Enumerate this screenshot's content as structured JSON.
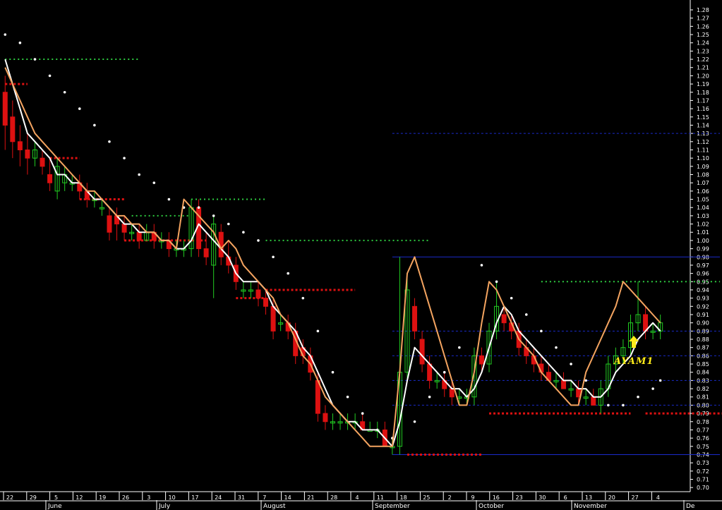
{
  "chart_data": {
    "type": "line",
    "subtype": "candlestick",
    "title": "",
    "xlabel": "",
    "ylabel": "",
    "ylim": [
      0.7,
      1.29
    ],
    "y_ticks": [
      0.7,
      0.71,
      0.72,
      0.73,
      0.74,
      0.75,
      0.76,
      0.77,
      0.78,
      0.79,
      0.8,
      0.81,
      0.82,
      0.83,
      0.84,
      0.85,
      0.86,
      0.87,
      0.88,
      0.89,
      0.9,
      0.91,
      0.92,
      0.93,
      0.94,
      0.95,
      0.96,
      0.97,
      0.98,
      0.99,
      1.0,
      1.01,
      1.02,
      1.03,
      1.04,
      1.05,
      1.06,
      1.07,
      1.08,
      1.09,
      1.1,
      1.11,
      1.12,
      1.13,
      1.14,
      1.15,
      1.16,
      1.17,
      1.18,
      1.19,
      1.2,
      1.21,
      1.22,
      1.23,
      1.24,
      1.25,
      1.26,
      1.27,
      1.28
    ],
    "y_axis_side": "right",
    "x_day_ticks": [
      "22",
      "29",
      "5",
      "12",
      "19",
      "26",
      "3",
      "10",
      "17",
      "24",
      "31",
      "7",
      "14",
      "21",
      "28",
      "4",
      "11",
      "18",
      "25",
      "2",
      "9",
      "16",
      "23",
      "30",
      "6",
      "13",
      "20",
      "27",
      "4"
    ],
    "x_months": [
      "June",
      "July",
      "August",
      "September",
      "October",
      "November",
      "De"
    ],
    "grid": false,
    "annotations": [
      {
        "text": "AYAM1",
        "marker": "yellow up arrow"
      }
    ],
    "colors": {
      "background": "#000000",
      "up_candle": "#22cc22",
      "down_candle": "#dd1111",
      "fast_line": "#ffffff",
      "slow_line": "#f4a460",
      "parabolic_sar": "#ffffff",
      "support_line": "#1a2bcc",
      "resistance_dotted": "#2ecc40",
      "stop_dotted": "#dd1111",
      "annotation": "#ffeb1a"
    },
    "candles": [
      {
        "t": 0,
        "o": 1.18,
        "h": 1.2,
        "l": 1.11,
        "c": 1.14
      },
      {
        "t": 1,
        "o": 1.15,
        "h": 1.17,
        "l": 1.1,
        "c": 1.12
      },
      {
        "t": 2,
        "o": 1.12,
        "h": 1.14,
        "l": 1.09,
        "c": 1.11
      },
      {
        "t": 3,
        "o": 1.11,
        "h": 1.13,
        "l": 1.08,
        "c": 1.1
      },
      {
        "t": 4,
        "o": 1.1,
        "h": 1.12,
        "l": 1.09,
        "c": 1.11
      },
      {
        "t": 5,
        "o": 1.1,
        "h": 1.11,
        "l": 1.08,
        "c": 1.09
      },
      {
        "t": 6,
        "o": 1.08,
        "h": 1.1,
        "l": 1.06,
        "c": 1.07
      },
      {
        "t": 7,
        "o": 1.06,
        "h": 1.1,
        "l": 1.05,
        "c": 1.09
      },
      {
        "t": 8,
        "o": 1.07,
        "h": 1.09,
        "l": 1.06,
        "c": 1.08
      },
      {
        "t": 9,
        "o": 1.07,
        "h": 1.08,
        "l": 1.06,
        "c": 1.07
      },
      {
        "t": 10,
        "o": 1.07,
        "h": 1.08,
        "l": 1.05,
        "c": 1.06
      },
      {
        "t": 11,
        "o": 1.06,
        "h": 1.07,
        "l": 1.04,
        "c": 1.05
      },
      {
        "t": 12,
        "o": 1.05,
        "h": 1.06,
        "l": 1.04,
        "c": 1.05
      },
      {
        "t": 13,
        "o": 1.04,
        "h": 1.05,
        "l": 1.03,
        "c": 1.04
      },
      {
        "t": 14,
        "o": 1.03,
        "h": 1.04,
        "l": 1.0,
        "c": 1.01
      },
      {
        "t": 15,
        "o": 1.03,
        "h": 1.04,
        "l": 1.0,
        "c": 1.02
      },
      {
        "t": 16,
        "o": 1.02,
        "h": 1.03,
        "l": 1.0,
        "c": 1.01
      },
      {
        "t": 17,
        "o": 1.01,
        "h": 1.02,
        "l": 1.0,
        "c": 1.01
      },
      {
        "t": 18,
        "o": 1.01,
        "h": 1.02,
        "l": 0.99,
        "c": 1.0
      },
      {
        "t": 19,
        "o": 1.0,
        "h": 1.02,
        "l": 1.0,
        "c": 1.01
      },
      {
        "t": 20,
        "o": 1.01,
        "h": 1.02,
        "l": 0.99,
        "c": 1.0
      },
      {
        "t": 21,
        "o": 1.0,
        "h": 1.01,
        "l": 0.99,
        "c": 1.0
      },
      {
        "t": 22,
        "o": 1.0,
        "h": 1.01,
        "l": 0.98,
        "c": 0.99
      },
      {
        "t": 23,
        "o": 0.99,
        "h": 1.0,
        "l": 0.98,
        "c": 0.99
      },
      {
        "t": 24,
        "o": 0.99,
        "h": 1.0,
        "l": 0.98,
        "c": 0.99
      },
      {
        "t": 25,
        "o": 0.99,
        "h": 1.05,
        "l": 0.98,
        "c": 1.04
      },
      {
        "t": 26,
        "o": 1.04,
        "h": 1.05,
        "l": 0.98,
        "c": 0.99
      },
      {
        "t": 27,
        "o": 0.99,
        "h": 1.01,
        "l": 0.97,
        "c": 0.98
      },
      {
        "t": 28,
        "o": 0.97,
        "h": 1.03,
        "l": 0.93,
        "c": 1.02
      },
      {
        "t": 29,
        "o": 1.01,
        "h": 1.02,
        "l": 0.97,
        "c": 0.98
      },
      {
        "t": 30,
        "o": 0.98,
        "h": 1.0,
        "l": 0.96,
        "c": 0.97
      },
      {
        "t": 31,
        "o": 0.97,
        "h": 0.98,
        "l": 0.94,
        "c": 0.95
      },
      {
        "t": 32,
        "o": 0.94,
        "h": 0.95,
        "l": 0.93,
        "c": 0.94
      },
      {
        "t": 33,
        "o": 0.94,
        "h": 0.95,
        "l": 0.93,
        "c": 0.94
      },
      {
        "t": 34,
        "o": 0.94,
        "h": 0.95,
        "l": 0.92,
        "c": 0.93
      },
      {
        "t": 35,
        "o": 0.93,
        "h": 0.94,
        "l": 0.91,
        "c": 0.92
      },
      {
        "t": 36,
        "o": 0.92,
        "h": 0.93,
        "l": 0.88,
        "c": 0.89
      },
      {
        "t": 37,
        "o": 0.9,
        "h": 0.91,
        "l": 0.89,
        "c": 0.9
      },
      {
        "t": 38,
        "o": 0.9,
        "h": 0.91,
        "l": 0.88,
        "c": 0.89
      },
      {
        "t": 39,
        "o": 0.89,
        "h": 0.9,
        "l": 0.85,
        "c": 0.86
      },
      {
        "t": 40,
        "o": 0.87,
        "h": 0.88,
        "l": 0.85,
        "c": 0.86
      },
      {
        "t": 41,
        "o": 0.86,
        "h": 0.87,
        "l": 0.83,
        "c": 0.84
      },
      {
        "t": 42,
        "o": 0.83,
        "h": 0.84,
        "l": 0.78,
        "c": 0.79
      },
      {
        "t": 43,
        "o": 0.79,
        "h": 0.8,
        "l": 0.77,
        "c": 0.78
      },
      {
        "t": 44,
        "o": 0.78,
        "h": 0.79,
        "l": 0.77,
        "c": 0.78
      },
      {
        "t": 45,
        "o": 0.78,
        "h": 0.79,
        "l": 0.77,
        "c": 0.78
      },
      {
        "t": 46,
        "o": 0.78,
        "h": 0.79,
        "l": 0.77,
        "c": 0.78
      },
      {
        "t": 47,
        "o": 0.78,
        "h": 0.79,
        "l": 0.77,
        "c": 0.78
      },
      {
        "t": 48,
        "o": 0.78,
        "h": 0.79,
        "l": 0.77,
        "c": 0.77
      },
      {
        "t": 49,
        "o": 0.77,
        "h": 0.78,
        "l": 0.77,
        "c": 0.77
      },
      {
        "t": 50,
        "o": 0.77,
        "h": 0.78,
        "l": 0.76,
        "c": 0.77
      },
      {
        "t": 51,
        "o": 0.77,
        "h": 0.78,
        "l": 0.75,
        "c": 0.75
      },
      {
        "t": 52,
        "o": 0.75,
        "h": 0.76,
        "l": 0.74,
        "c": 0.75
      },
      {
        "t": 53,
        "o": 0.75,
        "h": 0.98,
        "l": 0.74,
        "c": 0.84
      },
      {
        "t": 54,
        "o": 0.84,
        "h": 0.96,
        "l": 0.83,
        "c": 0.94
      },
      {
        "t": 55,
        "o": 0.92,
        "h": 0.93,
        "l": 0.88,
        "c": 0.89
      },
      {
        "t": 56,
        "o": 0.88,
        "h": 0.89,
        "l": 0.84,
        "c": 0.85
      },
      {
        "t": 57,
        "o": 0.85,
        "h": 0.86,
        "l": 0.82,
        "c": 0.83
      },
      {
        "t": 58,
        "o": 0.83,
        "h": 0.84,
        "l": 0.82,
        "c": 0.83
      },
      {
        "t": 59,
        "o": 0.83,
        "h": 0.84,
        "l": 0.81,
        "c": 0.82
      },
      {
        "t": 60,
        "o": 0.82,
        "h": 0.83,
        "l": 0.8,
        "c": 0.81
      },
      {
        "t": 61,
        "o": 0.81,
        "h": 0.82,
        "l": 0.8,
        "c": 0.81
      },
      {
        "t": 62,
        "o": 0.81,
        "h": 0.82,
        "l": 0.8,
        "c": 0.81
      },
      {
        "t": 63,
        "o": 0.81,
        "h": 0.87,
        "l": 0.8,
        "c": 0.86
      },
      {
        "t": 64,
        "o": 0.86,
        "h": 0.87,
        "l": 0.84,
        "c": 0.85
      },
      {
        "t": 65,
        "o": 0.85,
        "h": 0.9,
        "l": 0.84,
        "c": 0.89
      },
      {
        "t": 66,
        "o": 0.89,
        "h": 0.95,
        "l": 0.88,
        "c": 0.92
      },
      {
        "t": 67,
        "o": 0.91,
        "h": 0.92,
        "l": 0.89,
        "c": 0.9
      },
      {
        "t": 68,
        "o": 0.9,
        "h": 0.91,
        "l": 0.88,
        "c": 0.89
      },
      {
        "t": 69,
        "o": 0.89,
        "h": 0.9,
        "l": 0.86,
        "c": 0.87
      },
      {
        "t": 70,
        "o": 0.87,
        "h": 0.88,
        "l": 0.85,
        "c": 0.86
      },
      {
        "t": 71,
        "o": 0.86,
        "h": 0.87,
        "l": 0.84,
        "c": 0.85
      },
      {
        "t": 72,
        "o": 0.85,
        "h": 0.86,
        "l": 0.83,
        "c": 0.84
      },
      {
        "t": 73,
        "o": 0.84,
        "h": 0.85,
        "l": 0.83,
        "c": 0.83
      },
      {
        "t": 74,
        "o": 0.83,
        "h": 0.84,
        "l": 0.82,
        "c": 0.83
      },
      {
        "t": 75,
        "o": 0.83,
        "h": 0.84,
        "l": 0.82,
        "c": 0.82
      },
      {
        "t": 76,
        "o": 0.82,
        "h": 0.83,
        "l": 0.81,
        "c": 0.82
      },
      {
        "t": 77,
        "o": 0.82,
        "h": 0.83,
        "l": 0.8,
        "c": 0.81
      },
      {
        "t": 78,
        "o": 0.81,
        "h": 0.82,
        "l": 0.8,
        "c": 0.81
      },
      {
        "t": 79,
        "o": 0.81,
        "h": 0.82,
        "l": 0.8,
        "c": 0.8
      },
      {
        "t": 80,
        "o": 0.8,
        "h": 0.83,
        "l": 0.79,
        "c": 0.82
      },
      {
        "t": 81,
        "o": 0.82,
        "h": 0.86,
        "l": 0.81,
        "c": 0.85
      },
      {
        "t": 82,
        "o": 0.85,
        "h": 0.87,
        "l": 0.84,
        "c": 0.86
      },
      {
        "t": 83,
        "o": 0.86,
        "h": 0.88,
        "l": 0.85,
        "c": 0.87
      },
      {
        "t": 84,
        "o": 0.87,
        "h": 0.91,
        "l": 0.86,
        "c": 0.9
      },
      {
        "t": 85,
        "o": 0.9,
        "h": 0.95,
        "l": 0.89,
        "c": 0.91
      },
      {
        "t": 86,
        "o": 0.91,
        "h": 0.92,
        "l": 0.88,
        "c": 0.89
      },
      {
        "t": 87,
        "o": 0.89,
        "h": 0.9,
        "l": 0.88,
        "c": 0.89
      },
      {
        "t": 88,
        "o": 0.89,
        "h": 0.91,
        "l": 0.88,
        "c": 0.9
      }
    ],
    "series": [
      {
        "values": [
          1.22,
          1.19,
          1.16,
          1.13,
          1.12,
          1.11,
          1.1,
          1.08,
          1.08,
          1.07,
          1.07,
          1.06,
          1.05,
          1.05,
          1.04,
          1.03,
          1.02,
          1.02,
          1.01,
          1.01,
          1.01,
          1.0,
          1.0,
          0.99,
          0.99,
          1.0,
          1.02,
          1.01,
          1.0,
          0.99,
          0.98,
          0.96,
          0.95,
          0.95,
          0.95,
          0.94,
          0.92,
          0.91,
          0.9,
          0.89,
          0.87,
          0.86,
          0.84,
          0.82,
          0.8,
          0.79,
          0.78,
          0.78,
          0.77,
          0.77,
          0.77,
          0.76,
          0.75,
          0.78,
          0.83,
          0.87,
          0.86,
          0.85,
          0.84,
          0.83,
          0.82,
          0.82,
          0.81,
          0.82,
          0.84,
          0.87,
          0.9,
          0.92,
          0.91,
          0.89,
          0.88,
          0.87,
          0.86,
          0.85,
          0.84,
          0.83,
          0.83,
          0.82,
          0.82,
          0.81,
          0.81,
          0.82,
          0.84,
          0.85,
          0.86,
          0.88,
          0.89,
          0.9,
          0.89
        ]
      },
      {
        "values": [
          1.21,
          1.19,
          1.17,
          1.15,
          1.13,
          1.12,
          1.11,
          1.1,
          1.09,
          1.08,
          1.07,
          1.06,
          1.06,
          1.05,
          1.04,
          1.03,
          1.03,
          1.02,
          1.02,
          1.01,
          1.01,
          1.0,
          1.0,
          0.99,
          1.05,
          1.04,
          1.03,
          1.02,
          1.01,
          0.99,
          1.0,
          0.99,
          0.97,
          0.96,
          0.95,
          0.94,
          0.93,
          0.91,
          0.9,
          0.88,
          0.86,
          0.85,
          0.83,
          0.81,
          0.8,
          0.79,
          0.78,
          0.77,
          0.76,
          0.75,
          0.75,
          0.75,
          0.75,
          0.84,
          0.96,
          0.98,
          0.95,
          0.92,
          0.89,
          0.86,
          0.83,
          0.8,
          0.8,
          0.84,
          0.9,
          0.95,
          0.94,
          0.92,
          0.9,
          0.88,
          0.87,
          0.86,
          0.84,
          0.83,
          0.82,
          0.81,
          0.8,
          0.8,
          0.84,
          0.86,
          0.88,
          0.9,
          0.92,
          0.95,
          0.94,
          0.93,
          0.92,
          0.91,
          0.9
        ]
      }
    ],
    "sar": [
      {
        "t": 0,
        "v": 1.25
      },
      {
        "t": 2,
        "v": 1.24
      },
      {
        "t": 4,
        "v": 1.22
      },
      {
        "t": 6,
        "v": 1.2
      },
      {
        "t": 8,
        "v": 1.18
      },
      {
        "t": 10,
        "v": 1.16
      },
      {
        "t": 12,
        "v": 1.14
      },
      {
        "t": 14,
        "v": 1.12
      },
      {
        "t": 16,
        "v": 1.1
      },
      {
        "t": 18,
        "v": 1.08
      },
      {
        "t": 20,
        "v": 1.07
      },
      {
        "t": 22,
        "v": 1.05
      },
      {
        "t": 24,
        "v": 1.04
      },
      {
        "t": 26,
        "v": 1.04
      },
      {
        "t": 28,
        "v": 1.03
      },
      {
        "t": 30,
        "v": 1.02
      },
      {
        "t": 32,
        "v": 1.01
      },
      {
        "t": 34,
        "v": 1.0
      },
      {
        "t": 36,
        "v": 0.98
      },
      {
        "t": 38,
        "v": 0.96
      },
      {
        "t": 40,
        "v": 0.93
      },
      {
        "t": 42,
        "v": 0.89
      },
      {
        "t": 44,
        "v": 0.84
      },
      {
        "t": 46,
        "v": 0.81
      },
      {
        "t": 48,
        "v": 0.79
      },
      {
        "t": 50,
        "v": 0.77
      },
      {
        "t": 52,
        "v": 0.76
      },
      {
        "t": 55,
        "v": 0.78
      },
      {
        "t": 57,
        "v": 0.81
      },
      {
        "t": 59,
        "v": 0.84
      },
      {
        "t": 61,
        "v": 0.87
      },
      {
        "t": 64,
        "v": 0.97
      },
      {
        "t": 66,
        "v": 0.95
      },
      {
        "t": 68,
        "v": 0.93
      },
      {
        "t": 70,
        "v": 0.91
      },
      {
        "t": 72,
        "v": 0.89
      },
      {
        "t": 74,
        "v": 0.87
      },
      {
        "t": 76,
        "v": 0.85
      },
      {
        "t": 78,
        "v": 0.83
      },
      {
        "t": 81,
        "v": 0.8
      },
      {
        "t": 83,
        "v": 0.8
      },
      {
        "t": 85,
        "v": 0.81
      },
      {
        "t": 87,
        "v": 0.82
      },
      {
        "t": 88,
        "v": 0.83
      }
    ],
    "support_lines": [
      {
        "y": 1.13,
        "x0": 52,
        "x1": 96,
        "dashed": true
      },
      {
        "y": 0.98,
        "x0": 52,
        "x1": 96,
        "dashed": false
      },
      {
        "y": 0.89,
        "x0": 52,
        "x1": 96,
        "dashed": true
      },
      {
        "y": 0.86,
        "x0": 52,
        "x1": 96,
        "dashed": true
      },
      {
        "y": 0.83,
        "x0": 52,
        "x1": 96,
        "dashed": true
      },
      {
        "y": 0.8,
        "x0": 52,
        "x1": 96,
        "dashed": true
      },
      {
        "y": 0.74,
        "x0": 52,
        "x1": 96,
        "dashed": false
      }
    ],
    "resistance_levels": [
      {
        "y": 1.22,
        "x0": 0,
        "x1": 18
      },
      {
        "y": 1.05,
        "x0": 25,
        "x1": 35
      },
      {
        "y": 1.03,
        "x0": 17,
        "x1": 25
      },
      {
        "y": 1.0,
        "x0": 35,
        "x1": 57
      },
      {
        "y": 0.95,
        "x0": 72,
        "x1": 96
      }
    ],
    "stop_levels": [
      {
        "y": 1.19,
        "x0": 0,
        "x1": 3
      },
      {
        "y": 1.1,
        "x0": 6,
        "x1": 10
      },
      {
        "y": 1.05,
        "x0": 10,
        "x1": 16
      },
      {
        "y": 1.0,
        "x0": 16,
        "x1": 27
      },
      {
        "y": 0.94,
        "x0": 35,
        "x1": 47
      },
      {
        "y": 0.93,
        "x0": 31,
        "x1": 35
      },
      {
        "y": 0.79,
        "x0": 65,
        "x1": 84
      },
      {
        "y": 0.79,
        "x0": 86,
        "x1": 97
      },
      {
        "y": 0.74,
        "x0": 54,
        "x1": 64
      }
    ]
  }
}
